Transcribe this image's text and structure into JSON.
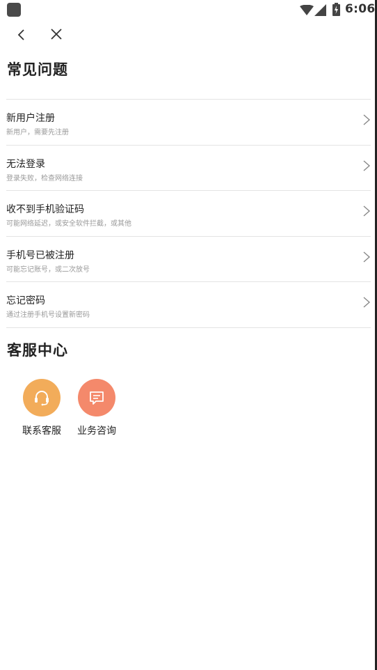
{
  "status_bar": {
    "time": "6:06"
  },
  "nav": {
    "back_icon": "chevron-left-icon",
    "close_icon": "close-icon"
  },
  "faq": {
    "title": "常见问题",
    "items": [
      {
        "title": "新用户注册",
        "desc": "新用户，需要先注册"
      },
      {
        "title": "无法登录",
        "desc": "登录失败，检查网络连接"
      },
      {
        "title": "收不到手机验证码",
        "desc": "可能网络延迟，或安全软件拦截，或其他"
      },
      {
        "title": "手机号已被注册",
        "desc": "可能忘记账号，或二次放号"
      },
      {
        "title": "忘记密码",
        "desc": "通过注册手机号设置新密码"
      }
    ]
  },
  "service": {
    "title": "客服中心",
    "items": [
      {
        "label": "联系客服",
        "icon": "headset-icon",
        "color": "#F2AC5A"
      },
      {
        "label": "业务咨询",
        "icon": "message-icon",
        "color": "#F4896B"
      }
    ]
  }
}
